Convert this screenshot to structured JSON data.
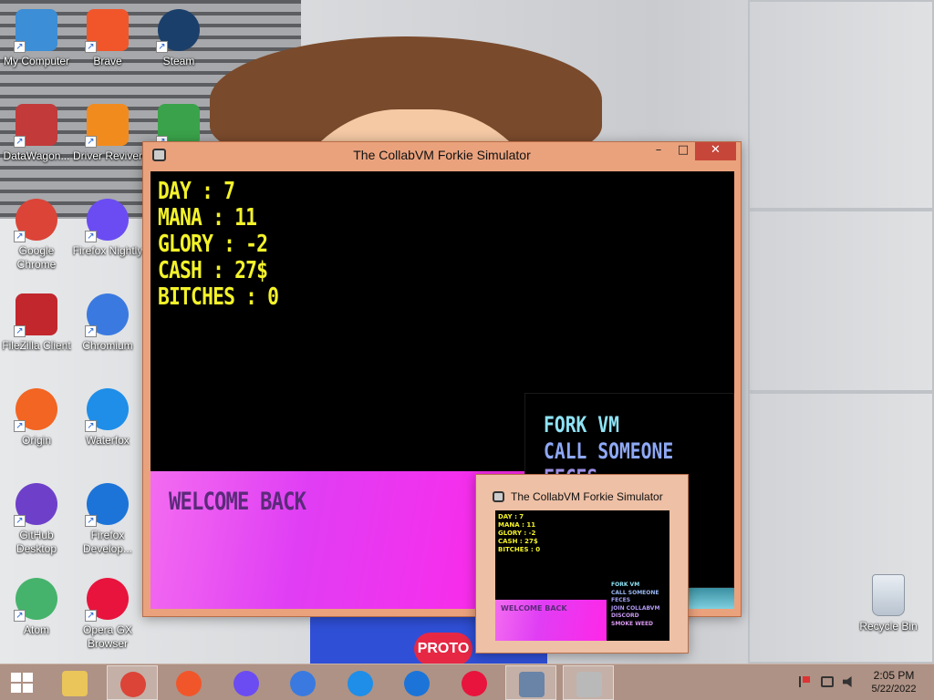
{
  "desktop": {
    "icons": [
      {
        "label": "My Computer",
        "icon": "computer-icon",
        "color": "#3c8ed6"
      },
      {
        "label": "Brave",
        "icon": "brave-icon",
        "color": "#f1562b"
      },
      {
        "label": "Steam",
        "icon": "steam-icon",
        "color": "#1b3f6b"
      },
      {
        "label": "DataWagon...",
        "icon": "datawagon-icon",
        "color": "#c23a3a"
      },
      {
        "label": "Driver Reviver",
        "icon": "driver-reviver-icon",
        "color": "#f28b1e"
      },
      {
        "label": "",
        "icon": "unknown-app-icon",
        "color": "#3aa24a"
      },
      {
        "label": "Google Chrome",
        "icon": "chrome-icon",
        "color": "#db4437"
      },
      {
        "label": "Firefox Nightly",
        "icon": "firefox-nightly-icon",
        "color": "#6b4cf2"
      },
      {
        "label": "FileZilla Client",
        "icon": "filezilla-icon",
        "color": "#c1272d"
      },
      {
        "label": "Chromium",
        "icon": "chromium-icon",
        "color": "#3a7ae0"
      },
      {
        "label": "Origin",
        "icon": "origin-icon",
        "color": "#f26522"
      },
      {
        "label": "Waterfox",
        "icon": "waterfox-icon",
        "color": "#1e8ee8"
      },
      {
        "label": "GitHub Desktop",
        "icon": "github-desktop-icon",
        "color": "#6e40c9"
      },
      {
        "label": "Firefox Develop...",
        "icon": "firefox-developer-icon",
        "color": "#1c74d8"
      },
      {
        "label": "Atom",
        "icon": "atom-icon",
        "color": "#45b36b"
      },
      {
        "label": "Opera GX Browser",
        "icon": "opera-gx-icon",
        "color": "#e8143d"
      }
    ],
    "recycle_bin": {
      "label": "Recycle Bin",
      "icon": "recycle-bin-icon"
    },
    "wallpaper_text": "PROTO"
  },
  "main_window": {
    "title": "The CollabVM Forkie Simulator",
    "minimize": "–",
    "maximize": "□",
    "close": "✕",
    "stats": [
      "DAY : 7",
      "MANA : 11",
      "GLORY : -2",
      "CASH : 27$",
      "BITCHES : 0"
    ],
    "menu": [
      {
        "label": "FORK VM",
        "color": "#8ee3f5"
      },
      {
        "label": "CALL SOMEONE",
        "color": "#8ea8f5"
      },
      {
        "label": "FECES",
        "color": "#a89af5"
      }
    ],
    "message": "WELCOME BACK"
  },
  "preview_window": {
    "title": "The CollabVM Forkie Simulator",
    "stats": [
      "DAY : 7",
      "MANA : 11",
      "GLORY : -2",
      "CASH : 27$",
      "BITCHES : 0"
    ],
    "menu": [
      {
        "label": "FORK VM",
        "color": "#8ee3f5"
      },
      {
        "label": "CALL SOMEONE",
        "color": "#9ab8f5"
      },
      {
        "label": "FECES",
        "color": "#a2a2f5"
      },
      {
        "label": "JOIN COLLABVM",
        "color": "#b19af5"
      },
      {
        "label": "DISCORD",
        "color": "#c79af0"
      },
      {
        "label": "SMOKE WEED",
        "color": "#d99af0"
      }
    ],
    "message": "WELCOME BACK"
  },
  "taskbar": {
    "items": [
      {
        "icon": "file-explorer-icon",
        "color": "#e9c55a"
      },
      {
        "icon": "chrome-icon",
        "color": "#db4437"
      },
      {
        "icon": "brave-icon",
        "color": "#f1562b"
      },
      {
        "icon": "firefox-nightly-icon",
        "color": "#6b4cf2"
      },
      {
        "icon": "chromium-icon",
        "color": "#3a7ae0"
      },
      {
        "icon": "waterfox-icon",
        "color": "#1e8ee8"
      },
      {
        "icon": "firefox-developer-icon",
        "color": "#1c74d8"
      },
      {
        "icon": "opera-gx-icon",
        "color": "#e8143d"
      },
      {
        "icon": "network-program-icon",
        "color": "#6a84a8"
      },
      {
        "icon": "forkie-simulator-icon",
        "color": "#b9b9b9"
      }
    ],
    "time": "2:05 PM",
    "date": "5/22/2022"
  }
}
